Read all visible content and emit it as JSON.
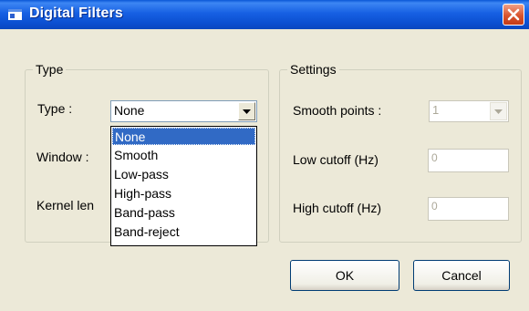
{
  "window": {
    "title": "Digital Filters",
    "close_label": "X"
  },
  "type_group": {
    "legend": "Type",
    "type_label": "Type :",
    "type_value": "None",
    "window_label": "Window :",
    "kernel_label": "Kernel len",
    "options": [
      "None",
      "Smooth",
      "Low-pass",
      "High-pass",
      "Band-pass",
      "Band-reject"
    ],
    "selected_index": 0
  },
  "settings_group": {
    "legend": "Settings",
    "smooth_label": "Smooth points :",
    "smooth_value": "1",
    "low_label": "Low cutoff  (Hz)",
    "low_value": "0",
    "high_label": "High cutoff  (Hz)",
    "high_value": "0"
  },
  "buttons": {
    "ok": "OK",
    "cancel": "Cancel"
  },
  "colors": {
    "titlebar": "#0a57d6",
    "selection": "#316ac5",
    "window_bg": "#ece9d8"
  }
}
